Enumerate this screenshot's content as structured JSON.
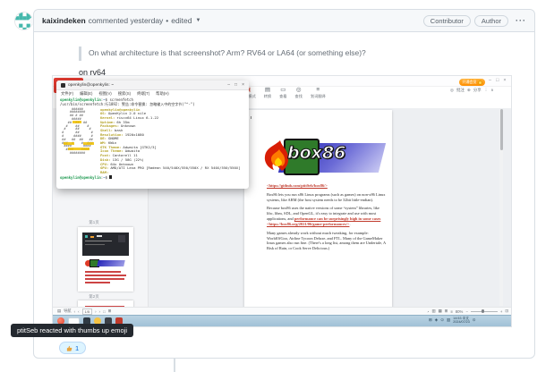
{
  "github": {
    "header": {
      "author": "kaixindeken",
      "action": "commented yesterday",
      "dot": "•",
      "edited": "edited",
      "badges": [
        "Contributor",
        "Author"
      ],
      "kebab": "···"
    },
    "quote": "On what architecture is that screenshot? Arm? RV64 or LA64 (or something else)?",
    "body": "on rv64",
    "reaction": {
      "emoji": "thumbs-up",
      "count": "1"
    },
    "tooltip": "ptitSeb reacted with thumbs up emoji",
    "colors": {
      "accent": "#0969da",
      "reaction_bg": "#ddf4ff",
      "header_bg": "#f6f8fa",
      "avatar_teal": "#45b8ac"
    }
  },
  "screenshot": {
    "app": {
      "vip_label": "开通会员",
      "window_controls": [
        "–",
        "□",
        "×"
      ],
      "toolbar": [
        "批注模式",
        "转换",
        "查看",
        "查找",
        "划词翻译"
      ],
      "quick_actions": [
        "批注",
        "分享"
      ],
      "collapse": "∧",
      "thumbnails": {
        "page1": "第1页",
        "page2": "第2页"
      },
      "statusbar": {
        "nav_label": "导航",
        "page": "1/5",
        "zoom": "80%",
        "minus": "−",
        "plus": "+"
      }
    },
    "taskbar": {
      "time": "14:53",
      "lang": "中文",
      "date": "2024/07/23"
    },
    "terminal": {
      "title": "openkylin@openkylin: ~",
      "menu": [
        "文件(F)",
        "编辑(E)",
        "视图(V)",
        "搜索(S)",
        "终端(T)",
        "帮助(H)"
      ],
      "prompt_user": "openkylin@openkylin",
      "prompt_colon": ":",
      "prompt_path": "~",
      "prompt_dollar": "$ ",
      "command": "screenfetch",
      "warning": "/usr/bin/screenfetch:行1892: 警告:命令替换: 忽略输入中的空字节(\"^-\")",
      "userline": "openkylin@openkylin",
      "art": [
        "      ######      ",
        "     ########     ",
        "     ## # ##      ",
        "      #####       ",
        "    ##  ##  ##    ",
        "   #    ##    #   ",
        "  #     ##     #  ",
        " #      ##      # ",
        " #     ####     # ",
        " ##   ##  ##   ## ",
        " ###  #    #  ### ",
        "  ####      ####  ",
        "   ####    ####   ",
        "     ########     "
      ],
      "info": [
        {
          "k": "OS:",
          "v": "OpenKylin 2.0 nile"
        },
        {
          "k": "Kernel:",
          "v": "riscv64 Linux 6.1.22"
        },
        {
          "k": "Uptime:",
          "v": "6h 35m"
        },
        {
          "k": "Packages:",
          "v": "Unknown"
        },
        {
          "k": "Shell:",
          "v": "bash"
        },
        {
          "k": "Resolution:",
          "v": "1920x1080"
        },
        {
          "k": "DE:",
          "v": "GNOME"
        },
        {
          "k": "WM:",
          "v": "KWin"
        },
        {
          "k": "GTK Theme:",
          "v": "Adwaita [GTK2/3]"
        },
        {
          "k": "Icon Theme:",
          "v": "Adwaita"
        },
        {
          "k": "Font:",
          "v": "Cantarell 11"
        },
        {
          "k": "Disk:",
          "v": "13G / 58G (22%)"
        },
        {
          "k": "CPU:",
          "v": "64x Unknown"
        },
        {
          "k": "GPU:",
          "v": "AMD/ATI Lexa PRO [Radeon 540/540X/550/550X / RX 540X/550/550X]"
        },
        {
          "k": "RAM:",
          "v": ""
        }
      ]
    },
    "document": {
      "logo_text": "box86",
      "link": "<https://github.com/ptitSeb/box86/>",
      "p1": "Box86 lets you run x86 Linux programs (such as games) on non-x86 Linux systems, like ARM (the host system needs to be 32bit little-endian).",
      "p2a": "Because box86 uses the native versions of some “system” libraries, like libc, libm, SDL, and OpenGL, it's easy to integrate and use with most applications, and ",
      "p2_link": "performance can be surprisingly high in some cases <https://box86.org/2021/06/game-performances/>",
      "p2b": ".",
      "p3": "Many games already work without much tweaking, for example: WorldOfGoo, Airline Tycoon Deluxe, and FTL. Many of the GameMaker linux games also run fine. (There's a long list, among them are Undertale, A Risk of Rain, or Cook Serve Delicious.)"
    }
  }
}
